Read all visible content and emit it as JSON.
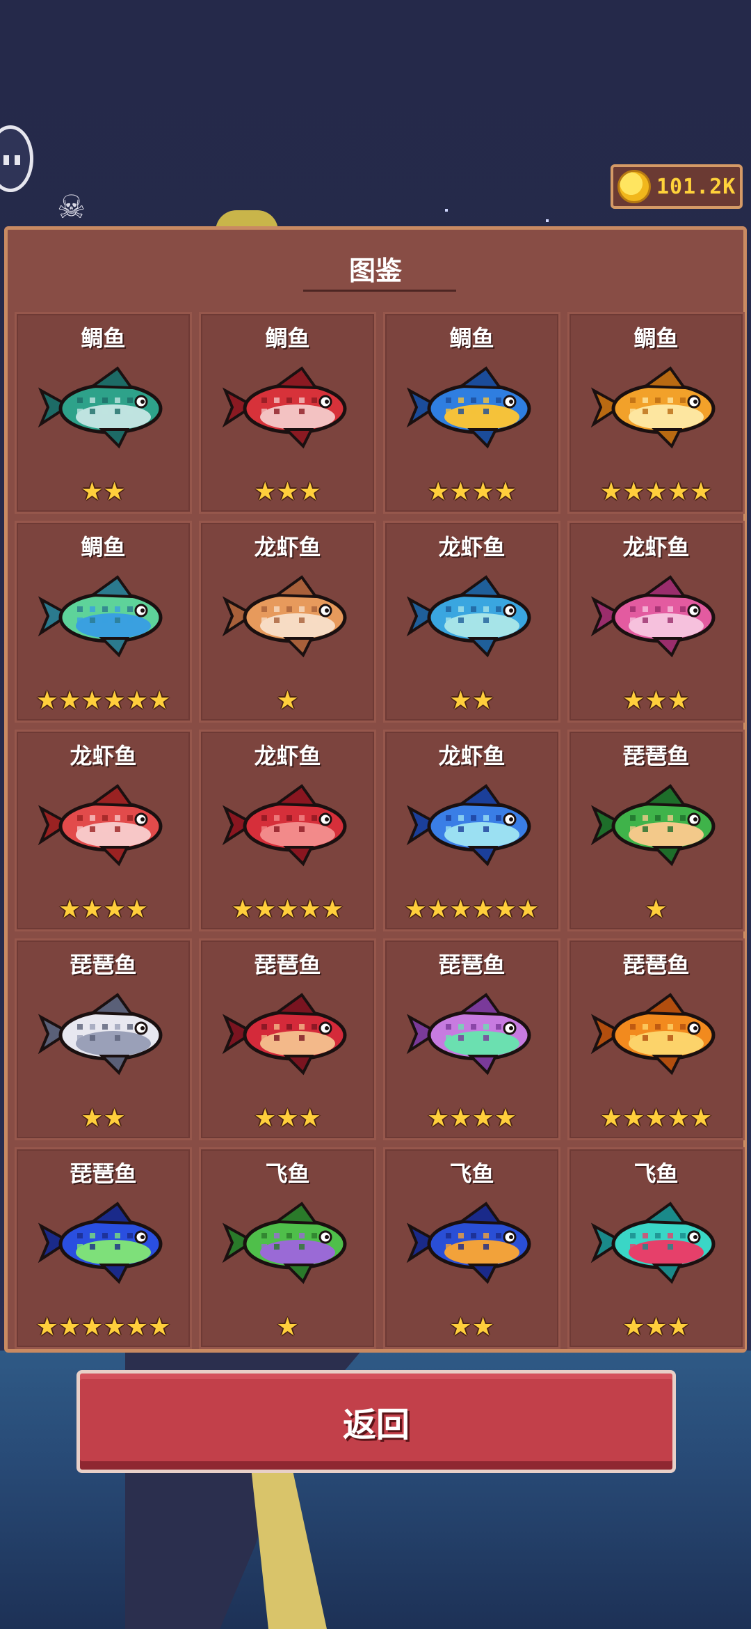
{
  "header": {
    "coins": "101.2K"
  },
  "panel": {
    "title": "图鉴"
  },
  "fish_cards": [
    {
      "name": "鲷鱼",
      "stars": 2,
      "palette": [
        "#2ea28a",
        "#bfe3e0",
        "#1d6b66"
      ]
    },
    {
      "name": "鲷鱼",
      "stars": 3,
      "palette": [
        "#d7323a",
        "#f3c2c2",
        "#8b1a22"
      ]
    },
    {
      "name": "鲷鱼",
      "stars": 4,
      "palette": [
        "#2f7ee0",
        "#f5c23a",
        "#1b4c9a"
      ]
    },
    {
      "name": "鲷鱼",
      "stars": 5,
      "palette": [
        "#f2a12a",
        "#fde6a0",
        "#b96a12"
      ]
    },
    {
      "name": "鲷鱼",
      "stars": 6,
      "palette": [
        "#5ed39a",
        "#3aa0e0",
        "#2b7a8e"
      ]
    },
    {
      "name": "龙虾鱼",
      "stars": 1,
      "palette": [
        "#e79a5c",
        "#f7dcc4",
        "#a8603a"
      ]
    },
    {
      "name": "龙虾鱼",
      "stars": 2,
      "palette": [
        "#3aa6e0",
        "#a6e4e8",
        "#1f5f9a"
      ]
    },
    {
      "name": "龙虾鱼",
      "stars": 3,
      "palette": [
        "#e35ba0",
        "#f6c1dd",
        "#9a2d6c"
      ]
    },
    {
      "name": "龙虾鱼",
      "stars": 4,
      "palette": [
        "#e24b4b",
        "#f7c7c7",
        "#9a2222"
      ]
    },
    {
      "name": "龙虾鱼",
      "stars": 5,
      "palette": [
        "#d62f3a",
        "#f28a8a",
        "#8a1620"
      ]
    },
    {
      "name": "龙虾鱼",
      "stars": 6,
      "palette": [
        "#3a7ee6",
        "#9be0f2",
        "#1b3f9a"
      ]
    },
    {
      "name": "琵琶鱼",
      "stars": 1,
      "palette": [
        "#3fb34a",
        "#f3c98a",
        "#1e6e2a"
      ]
    },
    {
      "name": "琵琶鱼",
      "stars": 2,
      "palette": [
        "#e8e8f0",
        "#9aa0b8",
        "#5a6078"
      ]
    },
    {
      "name": "琵琶鱼",
      "stars": 3,
      "palette": [
        "#d42a3a",
        "#f3b98a",
        "#7a1420"
      ]
    },
    {
      "name": "琵琶鱼",
      "stars": 4,
      "palette": [
        "#c77be0",
        "#6be0b0",
        "#7a3a9a"
      ]
    },
    {
      "name": "琵琶鱼",
      "stars": 5,
      "palette": [
        "#f28a1e",
        "#fcd36a",
        "#b24e0e"
      ]
    },
    {
      "name": "琵琶鱼",
      "stars": 6,
      "palette": [
        "#2a4fe0",
        "#7ee07a",
        "#1a2a8a"
      ]
    },
    {
      "name": "飞鱼",
      "stars": 1,
      "palette": [
        "#4fbf4a",
        "#9a6ad6",
        "#2a7a2a"
      ]
    },
    {
      "name": "飞鱼",
      "stars": 2,
      "palette": [
        "#2a4fd6",
        "#f2a23a",
        "#1a2a8a"
      ]
    },
    {
      "name": "飞鱼",
      "stars": 3,
      "palette": [
        "#3ad6c6",
        "#e6406a",
        "#1a8a8a"
      ]
    }
  ],
  "footer": {
    "back_label": "返回"
  },
  "colors": {
    "star": "#ffcf3c",
    "panel": "#884d45",
    "button": "#c2404a"
  }
}
